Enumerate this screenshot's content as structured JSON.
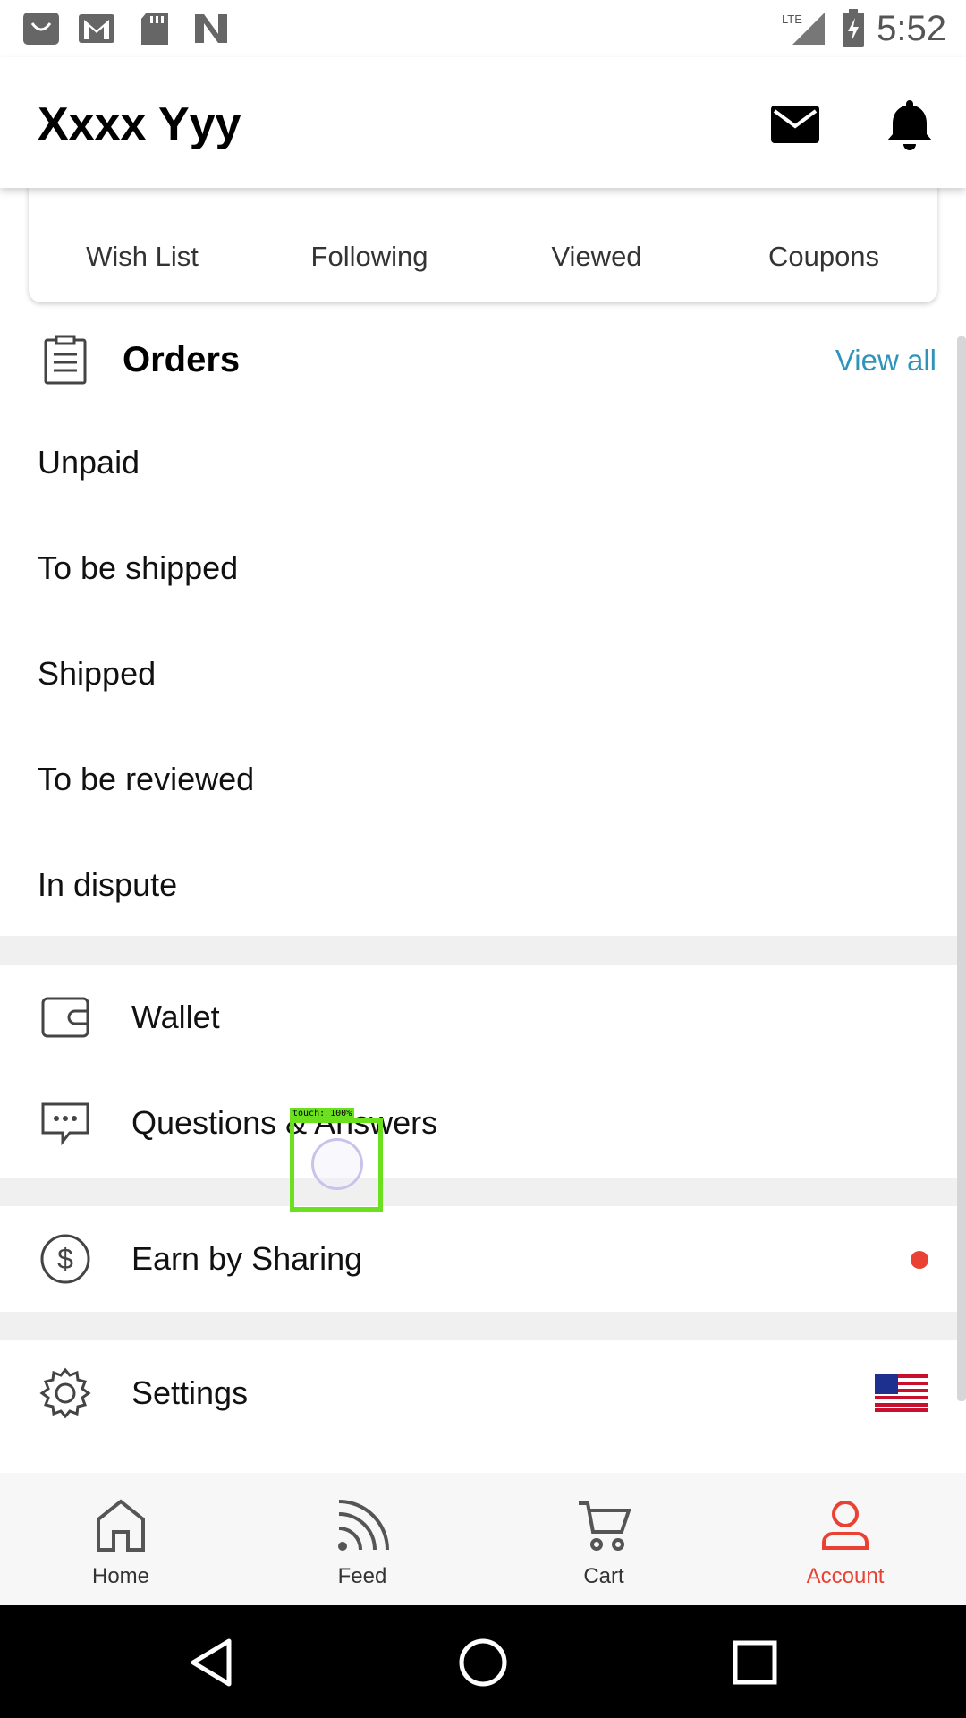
{
  "status_bar": {
    "time": "5:52",
    "network": "LTE",
    "icons": [
      "shopping-bag-icon",
      "gmail-icon",
      "sd-card-icon",
      "n-logo-icon",
      "signal-icon",
      "battery-charging-icon"
    ]
  },
  "header": {
    "user_name": "Xxxx Yyy",
    "icons": [
      "mail-icon",
      "bell-icon"
    ]
  },
  "quick_links": [
    {
      "label": "Wish List",
      "icon": "heart-icon"
    },
    {
      "label": "Following",
      "icon": "star-icon"
    },
    {
      "label": "Viewed",
      "icon": "clock-icon"
    },
    {
      "label": "Coupons",
      "icon": "coupon-icon"
    }
  ],
  "orders": {
    "title": "Orders",
    "view_all": "View all",
    "items": [
      "Unpaid",
      "To be shipped",
      "Shipped",
      "To be reviewed",
      "In dispute"
    ]
  },
  "menu": {
    "wallet": "Wallet",
    "qa": "Questions & Answers",
    "earn": "Earn by Sharing",
    "settings": "Settings"
  },
  "touch_indicator": {
    "text": "touch: 100%"
  },
  "bottom_nav": [
    {
      "label": "Home",
      "icon": "home-icon",
      "active": false
    },
    {
      "label": "Feed",
      "icon": "feed-icon",
      "active": false
    },
    {
      "label": "Cart",
      "icon": "cart-icon",
      "active": false
    },
    {
      "label": "Account",
      "icon": "account-icon",
      "active": true
    }
  ],
  "colors": {
    "accent": "#e94234",
    "link": "#2f93ba",
    "divider": "#f0f0f0"
  }
}
